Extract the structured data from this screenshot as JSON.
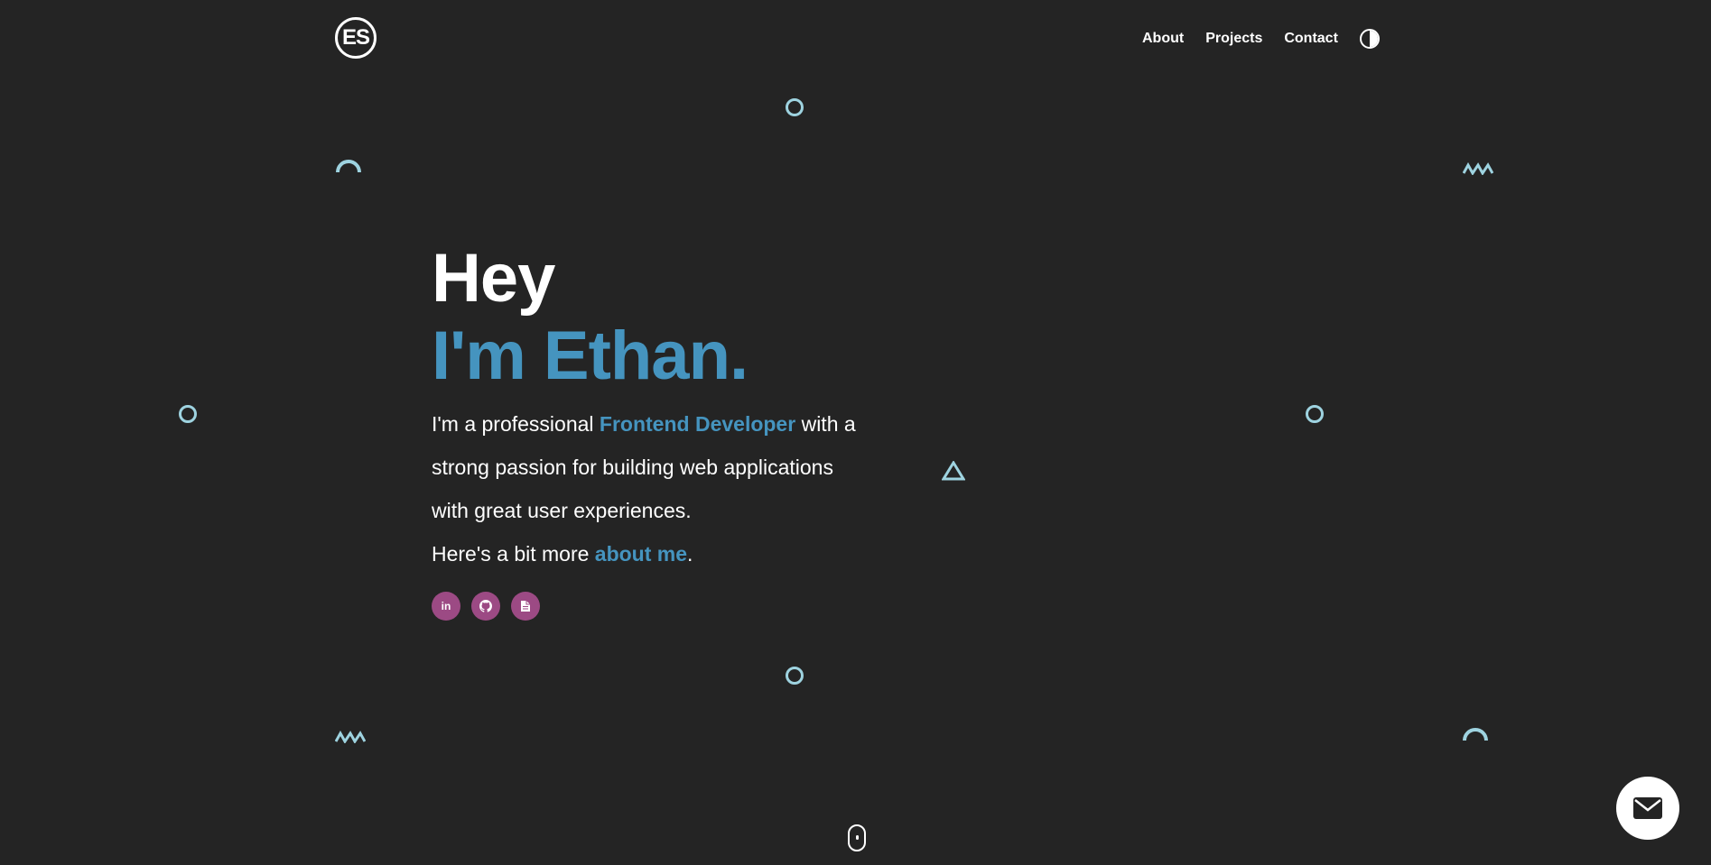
{
  "header": {
    "logo_text": "ES",
    "nav": [
      {
        "label": "About"
      },
      {
        "label": "Projects"
      },
      {
        "label": "Contact"
      }
    ],
    "theme_toggle_icon": "half-circle-contrast-icon"
  },
  "hero": {
    "greeting": "Hey",
    "name_line": "I'm Ethan.",
    "intro_before": "I'm a professional ",
    "intro_role": "Frontend Developer",
    "intro_after": " with a strong passion for building web applications with great user experiences.",
    "more_before": "Here's a bit more ",
    "more_link": "about me",
    "more_after": "."
  },
  "socials": [
    {
      "name": "linkedin",
      "glyph": "in"
    },
    {
      "name": "github",
      "icon": "github-icon"
    },
    {
      "name": "resume",
      "icon": "document-icon"
    }
  ],
  "colors": {
    "background": "#242424",
    "accent_blue": "#4594bf",
    "social_purple": "#9c4a84",
    "shape_cyan": "#9ed3e0"
  },
  "icons": {
    "scroll": "mouse-scroll-icon",
    "mail": "envelope-icon"
  }
}
